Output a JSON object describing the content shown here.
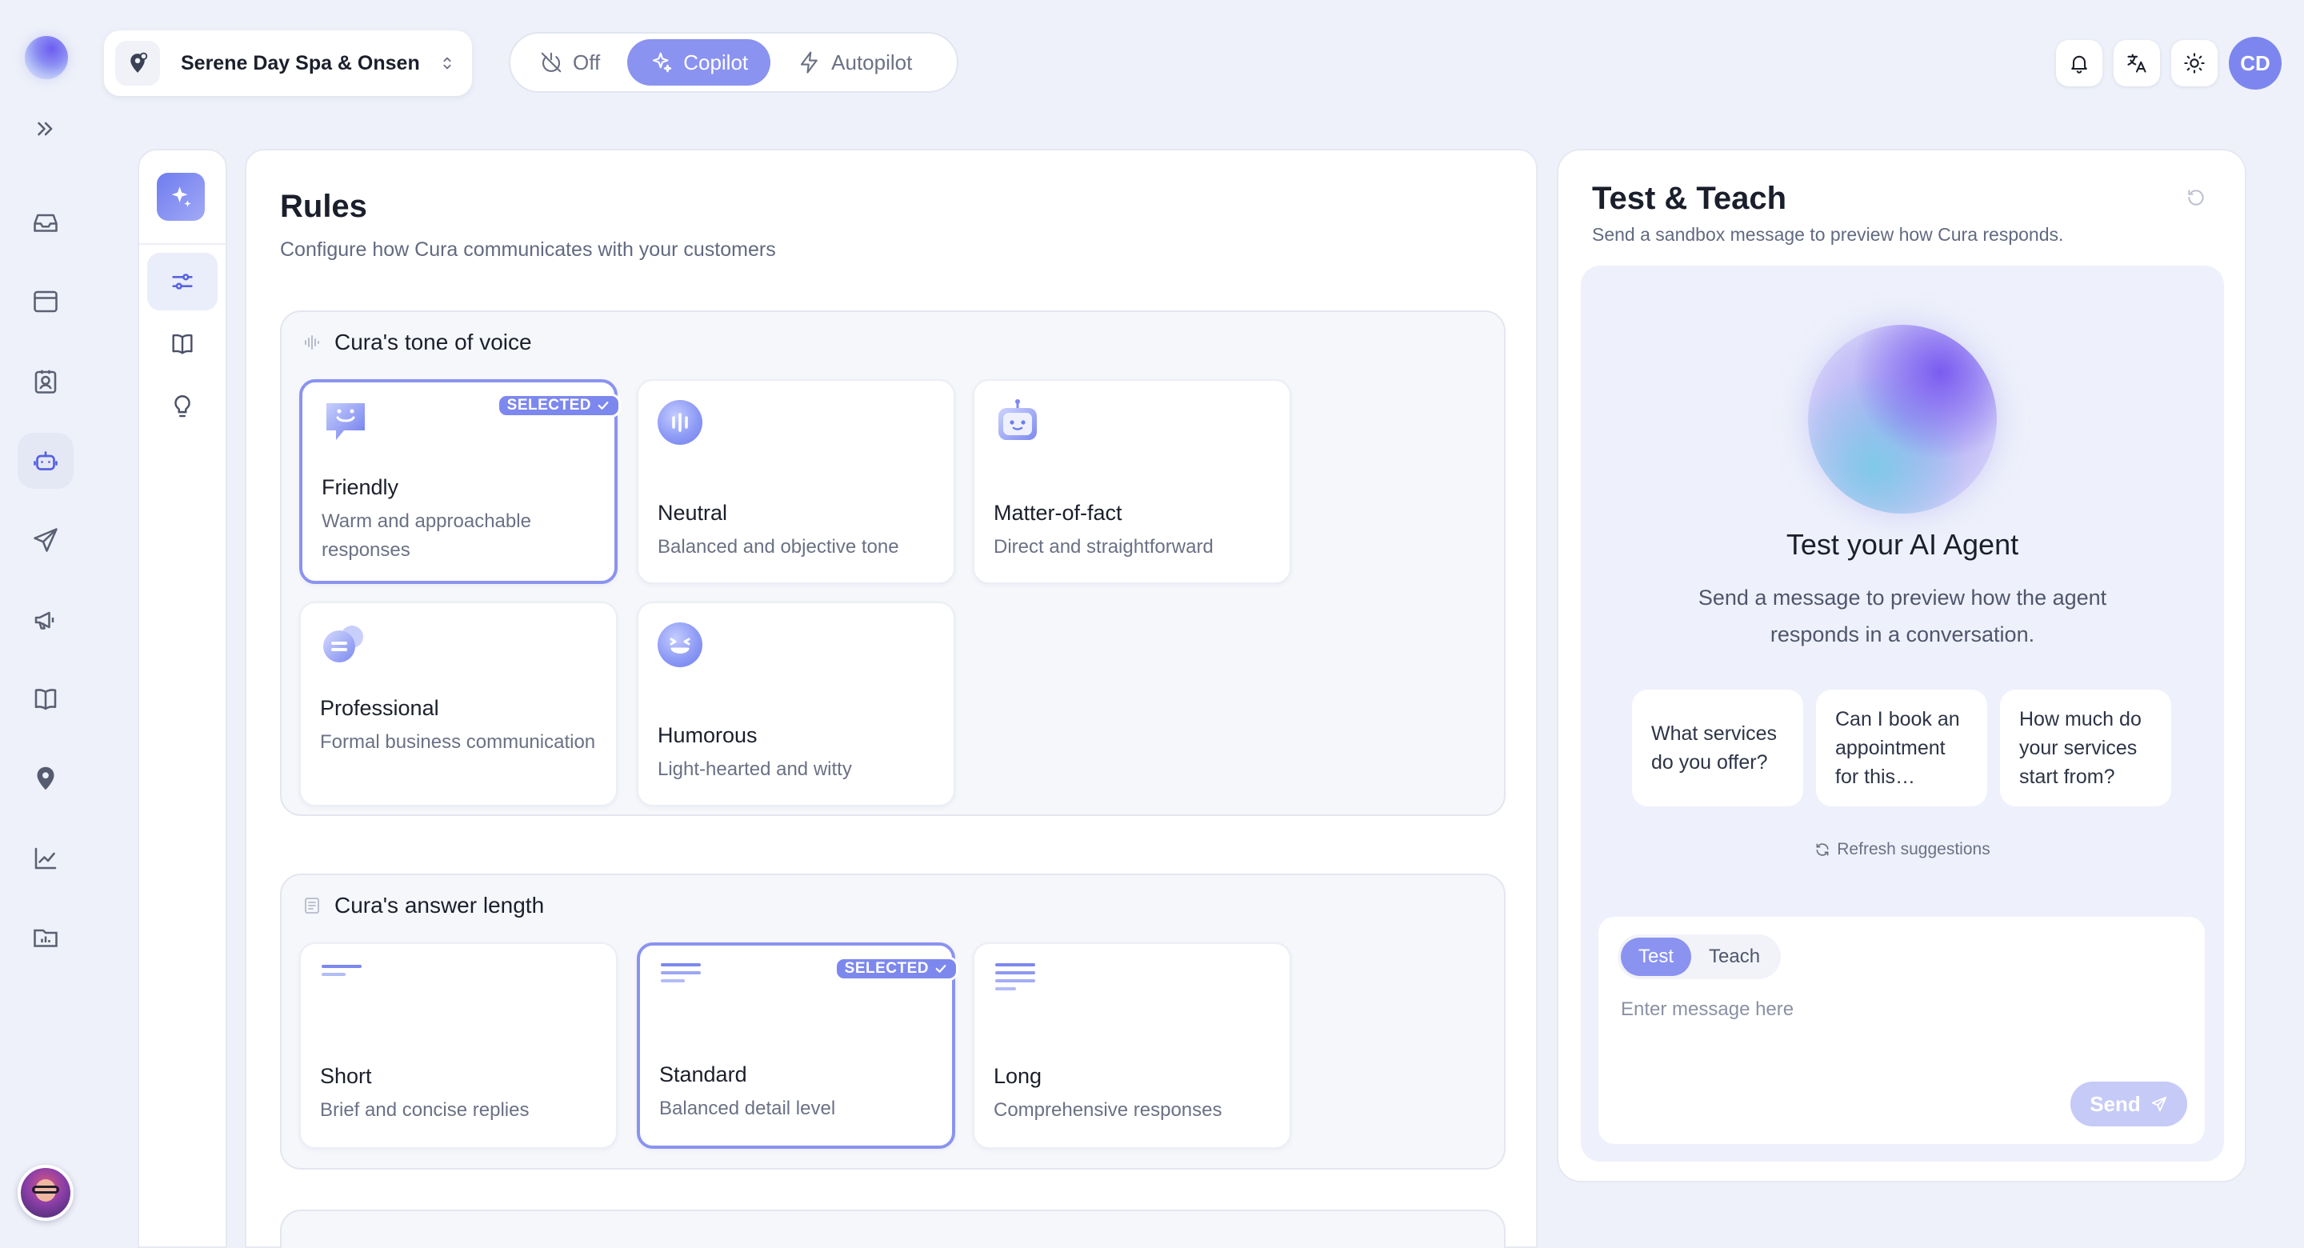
{
  "topbar": {
    "business_name": "Serene Day Spa & Onsen",
    "modes": [
      {
        "label": "Off",
        "icon": "off-icon"
      },
      {
        "label": "Copilot",
        "icon": "sparkle-icon"
      },
      {
        "label": "Autopilot",
        "icon": "bolt-icon"
      }
    ],
    "active_mode": "Copilot",
    "avatar_initials": "CD",
    "icons": [
      "bell-icon",
      "translate-icon",
      "sun-icon"
    ]
  },
  "rail": {
    "items": [
      "inbox-icon",
      "window-icon",
      "contacts-icon",
      "bot-icon",
      "send-icon",
      "megaphone-icon",
      "book-icon",
      "location-pin-icon",
      "chart-icon",
      "report-icon"
    ],
    "active": "bot-icon"
  },
  "subnav": {
    "items": [
      "rules-sliders-icon",
      "knowledge-book-icon",
      "lightbulb-icon"
    ],
    "active": "rules-sliders-icon"
  },
  "rules": {
    "title": "Rules",
    "subtitle": "Configure how Cura communicates with your customers",
    "selected_badge": "SELECTED",
    "tone": {
      "title": "Cura's tone of voice",
      "options": [
        {
          "title": "Friendly",
          "desc": "Warm and approachable responses",
          "selected": true
        },
        {
          "title": "Neutral",
          "desc": "Balanced and objective tone",
          "selected": false
        },
        {
          "title": "Matter-of-fact",
          "desc": "Direct and straightforward",
          "selected": false
        },
        {
          "title": "Professional",
          "desc": "Formal business communication",
          "selected": false
        },
        {
          "title": "Humorous",
          "desc": "Light-hearted and witty",
          "selected": false
        }
      ]
    },
    "length": {
      "title": "Cura's answer length",
      "options": [
        {
          "title": "Short",
          "desc": "Brief and concise replies",
          "selected": false
        },
        {
          "title": "Standard",
          "desc": "Balanced detail level",
          "selected": true
        },
        {
          "title": "Long",
          "desc": "Comprehensive responses",
          "selected": false
        }
      ]
    }
  },
  "test_teach": {
    "title": "Test & Teach",
    "subtitle": "Send a sandbox message to preview how Cura responds.",
    "heading": "Test your AI Agent",
    "description": "Send a message to preview how the agent responds in a conversation.",
    "suggestions": [
      "What services do you offer?",
      "Can I book an appointment for this…",
      "How much do your services start from?"
    ],
    "refresh_label": "Refresh suggestions",
    "tabs": [
      "Test",
      "Teach"
    ],
    "active_tab": "Test",
    "input_placeholder": "Enter message here",
    "send_label": "Send"
  },
  "colors": {
    "accent": "#8a93f0",
    "background": "#eef1f9"
  }
}
